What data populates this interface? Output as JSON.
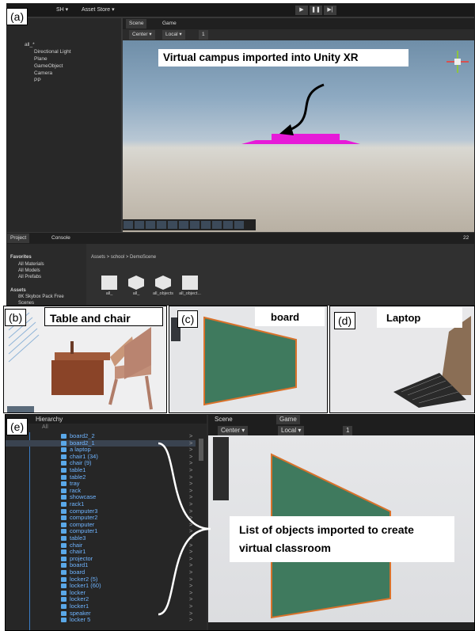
{
  "panel_labels": {
    "a": "(a)",
    "b": "(b)",
    "c": "(c)",
    "d": "(d)",
    "e": "(e)"
  },
  "callouts": {
    "a": "Virtual campus imported into Unity XR",
    "b": "Table and chair",
    "c": "board",
    "d": "Laptop",
    "e_line1": "List of objects imported to create",
    "e_line2": "virtual classroom"
  },
  "unity_a": {
    "topbar": {
      "account": "SH ▾",
      "asset_store": "Asset Store ▾"
    },
    "tabs": {
      "scene": "Scene",
      "game": "Game"
    },
    "toolbar": {
      "pivot": "Center ▾",
      "space": "Local ▾",
      "grid": "1"
    },
    "hierarchy": [
      {
        "label": "all_*"
      },
      {
        "label": "Directional Light"
      },
      {
        "label": "Plane"
      },
      {
        "label": "GameObject"
      },
      {
        "label": "Camera"
      },
      {
        "label": "PP"
      }
    ],
    "project_tabs": {
      "project": "Project",
      "console": "Console"
    },
    "favorites": {
      "title": "Favorites",
      "items": [
        "All Materials",
        "All Models",
        "All Prefabs"
      ]
    },
    "assets": {
      "title": "Assets",
      "items": [
        "8K Skybox Pack Free",
        "Scenes"
      ]
    },
    "breadcrumb": "Assets > school > DemoScene",
    "asset_items": [
      "all_",
      "all_",
      "all_objects",
      "all_object..."
    ],
    "count_badge": "22"
  },
  "unity_e": {
    "hierarchy_title": "Hierarchy",
    "search_placeholder": "All",
    "tabs": {
      "scene": "Scene",
      "game": "Game"
    },
    "toolbar": {
      "pivot": "Center ▾",
      "space": "Local ▾",
      "grid": "1"
    },
    "objects": [
      "board2_2",
      "board2_1",
      "a laptop",
      "chair1 (34)",
      "chair (9)",
      "table1",
      "table2",
      "tray",
      "rack",
      "showcase",
      "rack1",
      "computer3",
      "computer2",
      "computer",
      "computer1",
      "table3",
      "chair",
      "chair1",
      "projector",
      "board1",
      "board",
      "locker2 (5)",
      "locker1 (60)",
      "locker",
      "locker2",
      "locker1",
      "speaker",
      "locker 5"
    ]
  },
  "colors": {
    "magenta": "#e61ad8",
    "board_green": "#3f7a5e",
    "board_edge": "#d9722b",
    "hier_text": "#6fb4ff"
  }
}
